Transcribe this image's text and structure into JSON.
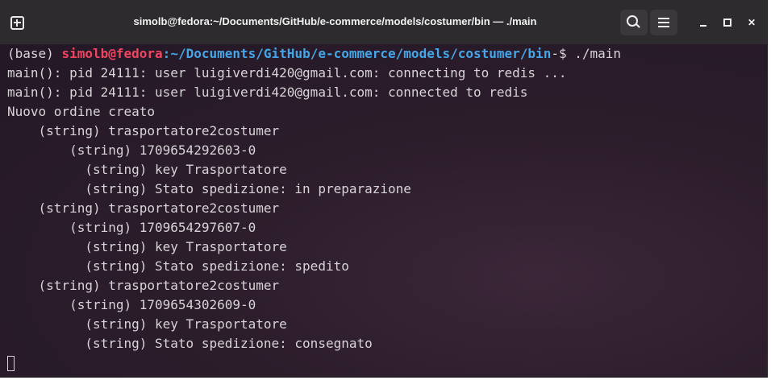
{
  "window": {
    "title": "simolb@fedora:~/Documents/GitHub/e-commerce/models/costumer/bin — ./main"
  },
  "icons": {
    "new_tab": "new-tab-icon",
    "search": "search-icon",
    "menu": "hamburger-menu-icon",
    "minimize": "minimize-icon",
    "maximize": "maximize-icon",
    "close": "close-icon"
  },
  "colors": {
    "prompt_user": "#ef4561",
    "prompt_path": "#44a6e8",
    "text": "#d7d4d7",
    "background": "#2b1e2b"
  },
  "prompt": {
    "env": "(base) ",
    "user_host": "simolb@fedora",
    "colon": ":",
    "path": "~/Documents/GitHub/e-commerce/models/costumer/bin",
    "symbol": "-$ ",
    "command": "./main"
  },
  "output_lines": [
    "main(): pid 24111: user luigiverdi420@gmail.com: connecting to redis ...",
    "main(): pid 24111: user luigiverdi420@gmail.com: connected to redis",
    "Nuovo ordine creato",
    "    (string) trasportatore2costumer",
    "        (string) 1709654292603-0",
    "          (string) key Trasportatore",
    "          (string) Stato spedizione: in preparazione",
    "    (string) trasportatore2costumer",
    "        (string) 1709654297607-0",
    "          (string) key Trasportatore",
    "          (string) Stato spedizione: spedito",
    "    (string) trasportatore2costumer",
    "        (string) 1709654302609-0",
    "          (string) key Trasportatore",
    "          (string) Stato spedizione: consegnato"
  ]
}
